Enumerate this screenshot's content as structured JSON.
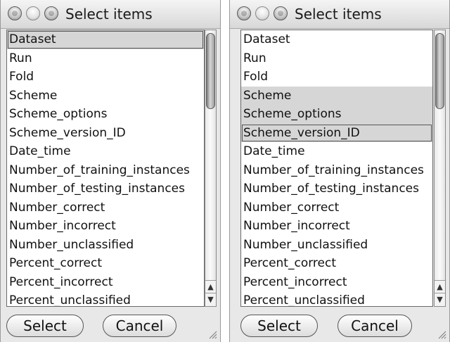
{
  "dialogs": [
    {
      "title": "Select items",
      "items": [
        {
          "label": "Dataset",
          "selected": true,
          "focused": true
        },
        {
          "label": "Run",
          "selected": false
        },
        {
          "label": "Fold",
          "selected": false
        },
        {
          "label": "Scheme",
          "selected": false
        },
        {
          "label": "Scheme_options",
          "selected": false
        },
        {
          "label": "Scheme_version_ID",
          "selected": false
        },
        {
          "label": "Date_time",
          "selected": false
        },
        {
          "label": "Number_of_training_instances",
          "selected": false
        },
        {
          "label": "Number_of_testing_instances",
          "selected": false
        },
        {
          "label": "Number_correct",
          "selected": false
        },
        {
          "label": "Number_incorrect",
          "selected": false
        },
        {
          "label": "Number_unclassified",
          "selected": false
        },
        {
          "label": "Percent_correct",
          "selected": false
        },
        {
          "label": "Percent_incorrect",
          "selected": false
        },
        {
          "label": "Percent_unclassified",
          "selected": false
        }
      ],
      "select_label": "Select",
      "cancel_label": "Cancel"
    },
    {
      "title": "Select items",
      "items": [
        {
          "label": "Dataset",
          "selected": false
        },
        {
          "label": "Run",
          "selected": false
        },
        {
          "label": "Fold",
          "selected": false
        },
        {
          "label": "Scheme",
          "selected": true
        },
        {
          "label": "Scheme_options",
          "selected": true
        },
        {
          "label": "Scheme_version_ID",
          "selected": true,
          "focused": true
        },
        {
          "label": "Date_time",
          "selected": false
        },
        {
          "label": "Number_of_training_instances",
          "selected": false
        },
        {
          "label": "Number_of_testing_instances",
          "selected": false
        },
        {
          "label": "Number_correct",
          "selected": false
        },
        {
          "label": "Number_incorrect",
          "selected": false
        },
        {
          "label": "Number_unclassified",
          "selected": false
        },
        {
          "label": "Percent_correct",
          "selected": false
        },
        {
          "label": "Percent_incorrect",
          "selected": false
        },
        {
          "label": "Percent_unclassified",
          "selected": false
        }
      ],
      "select_label": "Select",
      "cancel_label": "Cancel"
    }
  ]
}
